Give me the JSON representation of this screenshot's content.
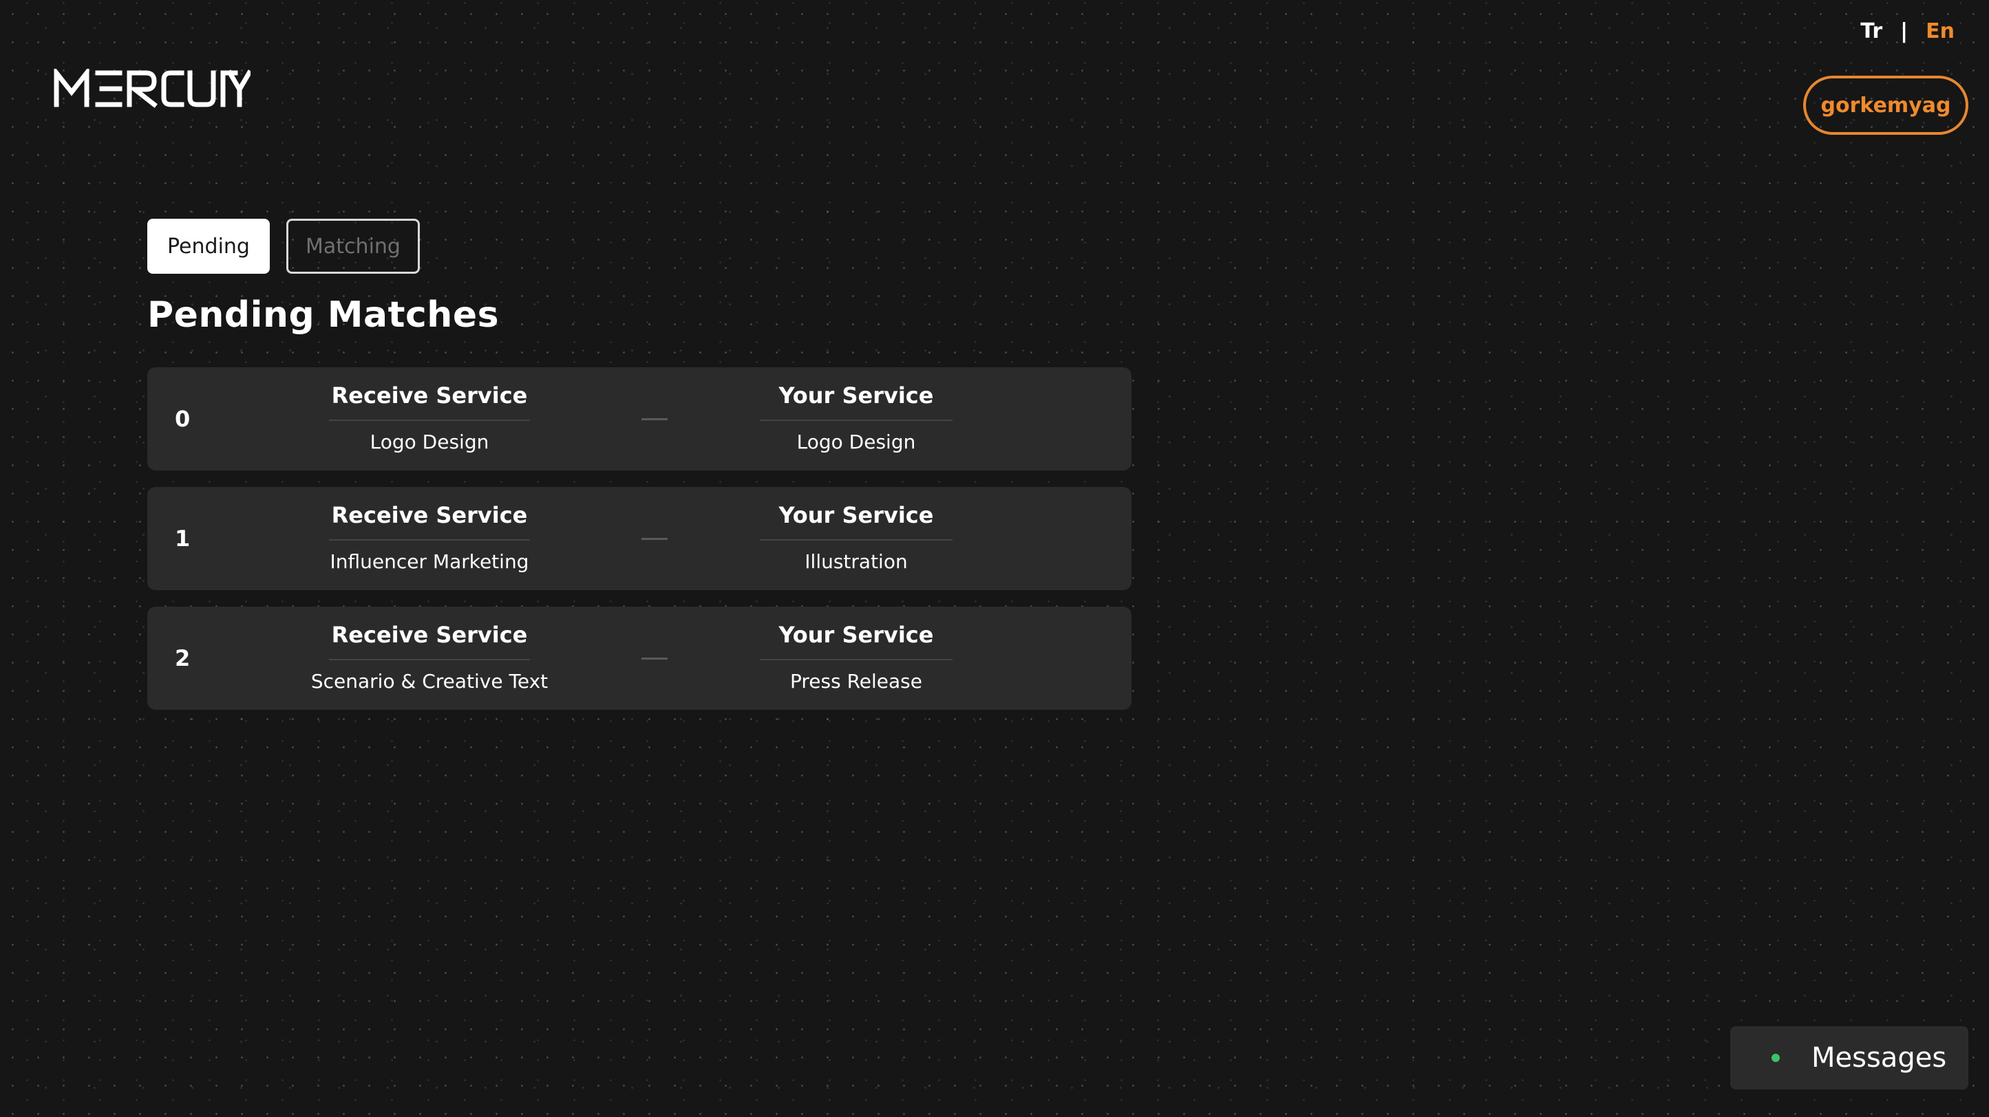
{
  "brand": {
    "logo_text": "MERCURY"
  },
  "language": {
    "tr": "Tr",
    "separator": "|",
    "en": "En",
    "active": "En"
  },
  "user": {
    "username": "gorkemyag"
  },
  "tabs": [
    {
      "label": "Pending",
      "active": true
    },
    {
      "label": "Matching",
      "active": false
    }
  ],
  "page": {
    "title": "Pending Matches"
  },
  "matches": [
    {
      "index": "0",
      "receive_title": "Receive Service",
      "receive_value": "Logo Design",
      "your_title": "Your Service",
      "your_value": "Logo Design"
    },
    {
      "index": "1",
      "receive_title": "Receive Service",
      "receive_value": "Influencer Marketing",
      "your_title": "Your Service",
      "your_value": "Illustration"
    },
    {
      "index": "2",
      "receive_title": "Receive Service",
      "receive_value": "Scenario & Creative Text",
      "your_title": "Your Service",
      "your_value": "Press Release"
    }
  ],
  "messages": {
    "label": "Messages",
    "status": "online"
  },
  "colors": {
    "background": "#161616",
    "accent": "#f08a2c",
    "card": "#2b2b2b",
    "online": "#3cc46a"
  }
}
